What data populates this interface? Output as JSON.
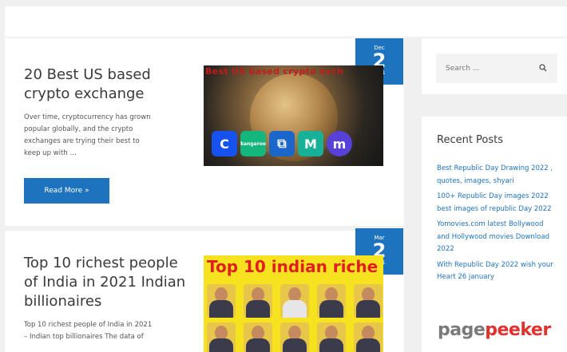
{
  "posts": [
    {
      "date": {
        "month": "Dec",
        "day": "2",
        "year": "2021"
      },
      "title_lines": [
        "20 Best US based",
        "crypto exchange"
      ],
      "excerpt_lines": [
        "Over time, cryptocurrency has grown",
        "popular globally, and the crypto",
        "exchanges are trying their best to",
        "keep up with …"
      ],
      "read_more": "Read More »",
      "image_caption": "Best US based crypto exch",
      "logo_labels": [
        "C",
        "kangaroo",
        "⧉",
        "M",
        "m"
      ],
      "logo_colors": [
        "#1552f0",
        "#13b67c",
        "#1b66c9",
        "#16b196",
        "#5741d9"
      ]
    },
    {
      "date": {
        "month": "Mar",
        "day": "2",
        "year": "2021"
      },
      "title_lines": [
        "Top 10 richest people",
        "of India in 2021 Indian",
        "billionaires"
      ],
      "excerpt_lines": [
        "Top 10 richest people of India in 2021",
        "– Indian top billionaires  The data of"
      ],
      "image_caption": "Top 10 indian riche"
    }
  ],
  "sidebar": {
    "search_placeholder": "Search ...",
    "recent_title": "Recent Posts",
    "recent_posts": [
      "Best Republic Day Drawing 2022 , quotes, images, shyari",
      "100+ Republic Day images 2022 best images of republic Day 2022",
      "Yomovies.com latest Bollywood and Hollywood movies Download 2022",
      "With Republic Day 2022 wish your Heart 26 january"
    ]
  },
  "watermark": {
    "part1": "page",
    "part2": "peeker"
  },
  "colors": {
    "accent": "#1e73be",
    "background": "#f0f0f0"
  }
}
